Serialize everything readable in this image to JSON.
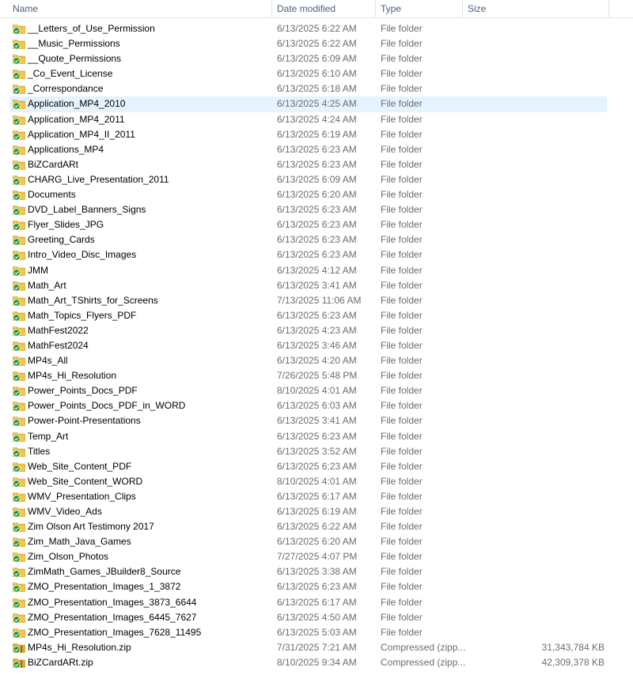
{
  "columns": {
    "name": "Name",
    "date": "Date modified",
    "type": "Type",
    "size": "Size"
  },
  "colors": {
    "folder": "#f5c64a",
    "zip": "#e0a830",
    "sync_ok": "#1e8c2f",
    "selection": "#e5f3ff"
  },
  "selected_index": 5,
  "files": [
    {
      "name": "__Letters_of_Use_Permission",
      "date": "6/13/2025 6:22 AM",
      "type": "File folder",
      "size": "",
      "icon": "folder-synced-icon"
    },
    {
      "name": "__Music_Permissions",
      "date": "6/13/2025 6:22 AM",
      "type": "File folder",
      "size": "",
      "icon": "folder-synced-icon"
    },
    {
      "name": "__Quote_Permissions",
      "date": "6/13/2025 6:09 AM",
      "type": "File folder",
      "size": "",
      "icon": "folder-synced-icon"
    },
    {
      "name": "_Co_Event_License",
      "date": "6/13/2025 6:10 AM",
      "type": "File folder",
      "size": "",
      "icon": "folder-synced-icon"
    },
    {
      "name": "_Correspondance",
      "date": "6/13/2025 6:18 AM",
      "type": "File folder",
      "size": "",
      "icon": "folder-synced-icon"
    },
    {
      "name": "Application_MP4_2010",
      "date": "6/13/2025 4:25 AM",
      "type": "File folder",
      "size": "",
      "icon": "folder-synced-icon"
    },
    {
      "name": "Application_MP4_2011",
      "date": "6/13/2025 4:24 AM",
      "type": "File folder",
      "size": "",
      "icon": "folder-synced-icon"
    },
    {
      "name": "Application_MP4_II_2011",
      "date": "6/13/2025 6:19 AM",
      "type": "File folder",
      "size": "",
      "icon": "folder-synced-icon"
    },
    {
      "name": "Applications_MP4",
      "date": "6/13/2025 6:23 AM",
      "type": "File folder",
      "size": "",
      "icon": "folder-synced-icon"
    },
    {
      "name": "BiZCardARt",
      "date": "6/13/2025 6:23 AM",
      "type": "File folder",
      "size": "",
      "icon": "folder-synced-icon"
    },
    {
      "name": "CHARG_Live_Presentation_2011",
      "date": "6/13/2025 6:09 AM",
      "type": "File folder",
      "size": "",
      "icon": "folder-synced-icon"
    },
    {
      "name": "Documents",
      "date": "6/13/2025 6:20 AM",
      "type": "File folder",
      "size": "",
      "icon": "folder-synced-icon"
    },
    {
      "name": "DVD_Label_Banners_Signs",
      "date": "6/13/2025 6:23 AM",
      "type": "File folder",
      "size": "",
      "icon": "folder-synced-icon"
    },
    {
      "name": "Flyer_Slides_JPG",
      "date": "6/13/2025 6:23 AM",
      "type": "File folder",
      "size": "",
      "icon": "folder-synced-icon"
    },
    {
      "name": "Greeting_Cards",
      "date": "6/13/2025 6:23 AM",
      "type": "File folder",
      "size": "",
      "icon": "folder-synced-icon"
    },
    {
      "name": "Intro_Video_Disc_Images",
      "date": "6/13/2025 6:23 AM",
      "type": "File folder",
      "size": "",
      "icon": "folder-synced-icon"
    },
    {
      "name": "JMM",
      "date": "6/13/2025 4:12 AM",
      "type": "File folder",
      "size": "",
      "icon": "folder-synced-icon"
    },
    {
      "name": "Math_Art",
      "date": "6/13/2025 3:41 AM",
      "type": "File folder",
      "size": "",
      "icon": "folder-synced-icon"
    },
    {
      "name": "Math_Art_TShirts_for_Screens",
      "date": "7/13/2025 11:06 AM",
      "type": "File folder",
      "size": "",
      "icon": "folder-synced-icon"
    },
    {
      "name": "Math_Topics_Flyers_PDF",
      "date": "6/13/2025 6:23 AM",
      "type": "File folder",
      "size": "",
      "icon": "folder-synced-icon"
    },
    {
      "name": "MathFest2022",
      "date": "6/13/2025 4:23 AM",
      "type": "File folder",
      "size": "",
      "icon": "folder-synced-icon"
    },
    {
      "name": "MathFest2024",
      "date": "6/13/2025 3:46 AM",
      "type": "File folder",
      "size": "",
      "icon": "folder-synced-icon"
    },
    {
      "name": "MP4s_All",
      "date": "6/13/2025 4:20 AM",
      "type": "File folder",
      "size": "",
      "icon": "folder-synced-icon"
    },
    {
      "name": "MP4s_Hi_Resolution",
      "date": "7/26/2025 5:48 PM",
      "type": "File folder",
      "size": "",
      "icon": "folder-synced-icon"
    },
    {
      "name": "Power_Points_Docs_PDF",
      "date": "8/10/2025 4:01 AM",
      "type": "File folder",
      "size": "",
      "icon": "folder-synced-icon"
    },
    {
      "name": "Power_Points_Docs_PDF_in_WORD",
      "date": "6/13/2025 6:03 AM",
      "type": "File folder",
      "size": "",
      "icon": "folder-synced-icon"
    },
    {
      "name": "Power-Point-Presentations",
      "date": "6/13/2025 3:41 AM",
      "type": "File folder",
      "size": "",
      "icon": "folder-synced-icon"
    },
    {
      "name": "Temp_Art",
      "date": "6/13/2025 6:23 AM",
      "type": "File folder",
      "size": "",
      "icon": "folder-synced-icon"
    },
    {
      "name": "Titles",
      "date": "6/13/2025 3:52 AM",
      "type": "File folder",
      "size": "",
      "icon": "folder-synced-icon"
    },
    {
      "name": "Web_Site_Content_PDF",
      "date": "6/13/2025 6:23 AM",
      "type": "File folder",
      "size": "",
      "icon": "folder-synced-icon"
    },
    {
      "name": "Web_Site_Content_WORD",
      "date": "8/10/2025 4:01 AM",
      "type": "File folder",
      "size": "",
      "icon": "folder-synced-icon"
    },
    {
      "name": "WMV_Presentation_Clips",
      "date": "6/13/2025 6:17 AM",
      "type": "File folder",
      "size": "",
      "icon": "folder-synced-icon"
    },
    {
      "name": "WMV_Video_Ads",
      "date": "6/13/2025 6:19 AM",
      "type": "File folder",
      "size": "",
      "icon": "folder-synced-icon"
    },
    {
      "name": "Zim Olson Art Testimony 2017",
      "date": "6/13/2025 6:22 AM",
      "type": "File folder",
      "size": "",
      "icon": "folder-synced-icon"
    },
    {
      "name": "Zim_Math_Java_Games",
      "date": "6/13/2025 6:20 AM",
      "type": "File folder",
      "size": "",
      "icon": "folder-synced-icon"
    },
    {
      "name": "Zim_Olson_Photos",
      "date": "7/27/2025 4:07 PM",
      "type": "File folder",
      "size": "",
      "icon": "folder-synced-icon"
    },
    {
      "name": "ZimMath_Games_JBuilder8_Source",
      "date": "6/13/2025 3:38 AM",
      "type": "File folder",
      "size": "",
      "icon": "folder-synced-icon"
    },
    {
      "name": "ZMO_Presentation_Images_1_3872",
      "date": "6/13/2025 6:23 AM",
      "type": "File folder",
      "size": "",
      "icon": "folder-synced-icon"
    },
    {
      "name": "ZMO_Presentation_Images_3873_6644",
      "date": "6/13/2025 6:17 AM",
      "type": "File folder",
      "size": "",
      "icon": "folder-synced-icon"
    },
    {
      "name": "ZMO_Presentation_Images_6445_7627",
      "date": "6/13/2025 4:50 AM",
      "type": "File folder",
      "size": "",
      "icon": "folder-synced-icon"
    },
    {
      "name": "ZMO_Presentation_Images_7628_11495",
      "date": "6/13/2025 5:03 AM",
      "type": "File folder",
      "size": "",
      "icon": "folder-synced-icon"
    },
    {
      "name": "MP4s_Hi_Resolution.zip",
      "date": "7/31/2025 7:21 AM",
      "type": "Compressed (zipp...",
      "size": "31,343,784 KB",
      "icon": "zip-synced-icon"
    },
    {
      "name": "BiZCardARt.zip",
      "date": "8/10/2025 9:34 AM",
      "type": "Compressed (zipp...",
      "size": "42,309,378 KB",
      "icon": "zip-synced-icon"
    }
  ]
}
